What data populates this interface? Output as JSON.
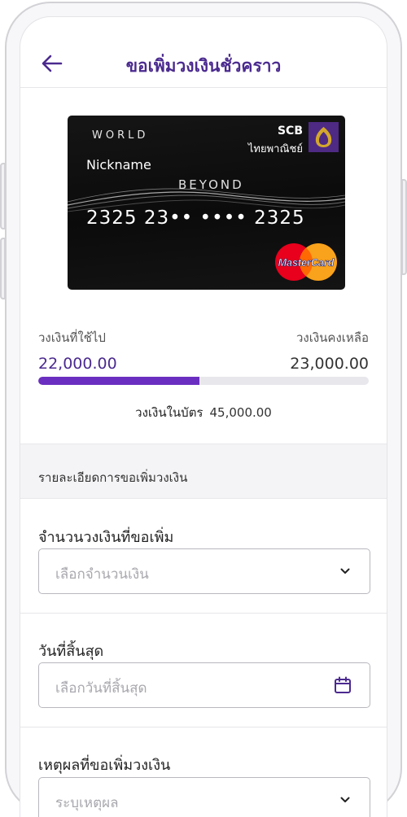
{
  "header": {
    "title": "ขอเพิ่มวงเงินชั่วคราว"
  },
  "card": {
    "tier": "WORLD",
    "bank_en": "SCB",
    "bank_th": "ไทยพาณิชย์",
    "nickname": "Nickname",
    "product": "BEYOND",
    "number": "2325 23•• •••• 2325",
    "network": "MasterCard"
  },
  "limits": {
    "used_label": "วงเงินที่ใช้ไป",
    "used_value": "22,000.00",
    "remaining_label": "วงเงินคงเหลือ",
    "remaining_value": "23,000.00",
    "used_fraction": 0.4889,
    "total_label": "วงเงินในบัตร",
    "total_value": "45,000.00"
  },
  "details": {
    "section_title": "รายละเอียดการขอเพิ่มวงเงิน",
    "amount_label": "จำนวนวงเงินที่ขอเพิ่ม",
    "amount_placeholder": "เลือกจำนวนเงิน",
    "end_date_label": "วันที่สิ้นสุด",
    "end_date_placeholder": "เลือกวันที่สิ้นสุด",
    "reason_label": "เหตุผลที่ขอเพิ่มวงเงิน",
    "reason_placeholder": "ระบุเหตุผล"
  },
  "colors": {
    "primary": "#4b2a8f",
    "progress": "#6a2fc0",
    "card_logo_bg": "#4e2a84"
  },
  "icons": {
    "back": "arrow-left-icon",
    "dropdown": "chevron-down-icon",
    "calendar": "calendar-icon"
  }
}
